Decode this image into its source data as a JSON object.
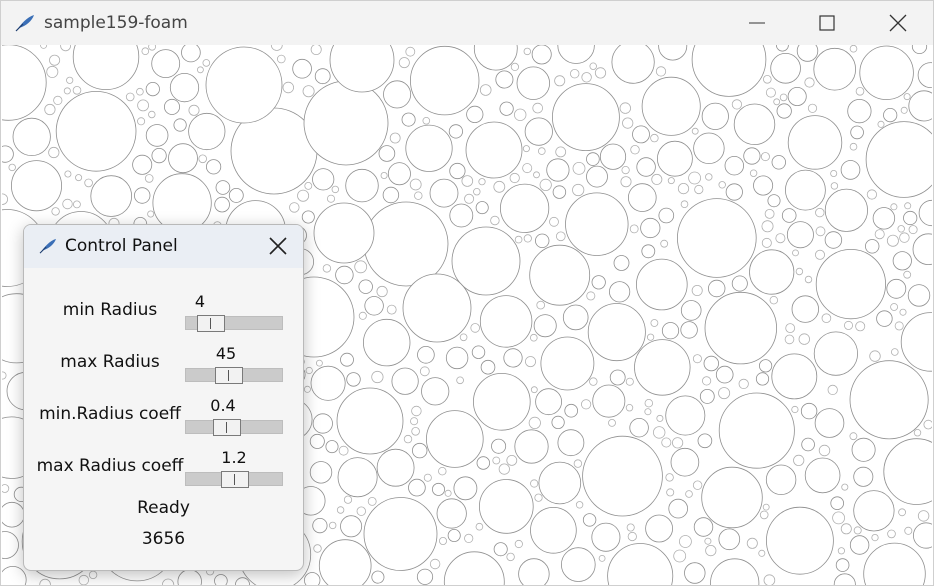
{
  "window": {
    "title": "sample159-foam"
  },
  "panel": {
    "title": "Control Panel",
    "sliders": [
      {
        "label": "min Radius",
        "value": "4",
        "level": 0.15
      },
      {
        "label": "max Radius",
        "value": "45",
        "level": 0.42
      },
      {
        "label": "min.Radius coeff",
        "value": "0.4",
        "level": 0.38
      },
      {
        "label": "max Radius coeff",
        "value": "1.2",
        "level": 0.5
      }
    ],
    "status": "Ready",
    "count": "3656"
  }
}
